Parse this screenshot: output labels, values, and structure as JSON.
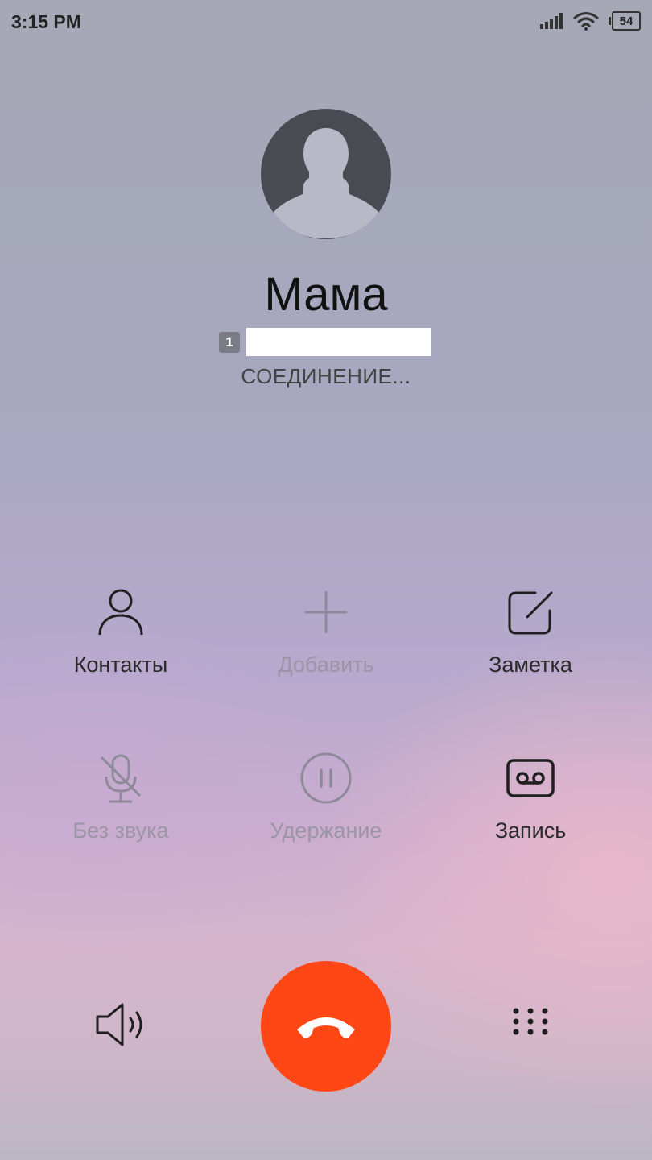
{
  "status_bar": {
    "time": "3:15 PM",
    "battery": "54",
    "icons": [
      "signal-icon",
      "wifi-icon",
      "battery-icon"
    ]
  },
  "contact": {
    "name": "Мама",
    "sim_slot": "1",
    "call_status": "СОЕДИНЕНИЕ..."
  },
  "actions": [
    {
      "id": "contacts",
      "label": "Контакты",
      "icon": "person-icon",
      "enabled": true
    },
    {
      "id": "add",
      "label": "Добавить",
      "icon": "plus-icon",
      "enabled": false
    },
    {
      "id": "note",
      "label": "Заметка",
      "icon": "note-edit-icon",
      "enabled": true
    },
    {
      "id": "mute",
      "label": "Без звука",
      "icon": "mic-off-icon",
      "enabled": false
    },
    {
      "id": "hold",
      "label": "Удержание",
      "icon": "pause-icon",
      "enabled": false
    },
    {
      "id": "record",
      "label": "Запись",
      "icon": "record-icon",
      "enabled": true
    }
  ],
  "bottom": {
    "speaker_icon": "speaker-icon",
    "end_call_icon": "end-call-icon",
    "end_call_color": "#ff4615",
    "keypad_icon": "keypad-icon"
  },
  "colors": {
    "active_icon": "#1f1f1f",
    "disabled_icon": "#8f8a9a"
  }
}
